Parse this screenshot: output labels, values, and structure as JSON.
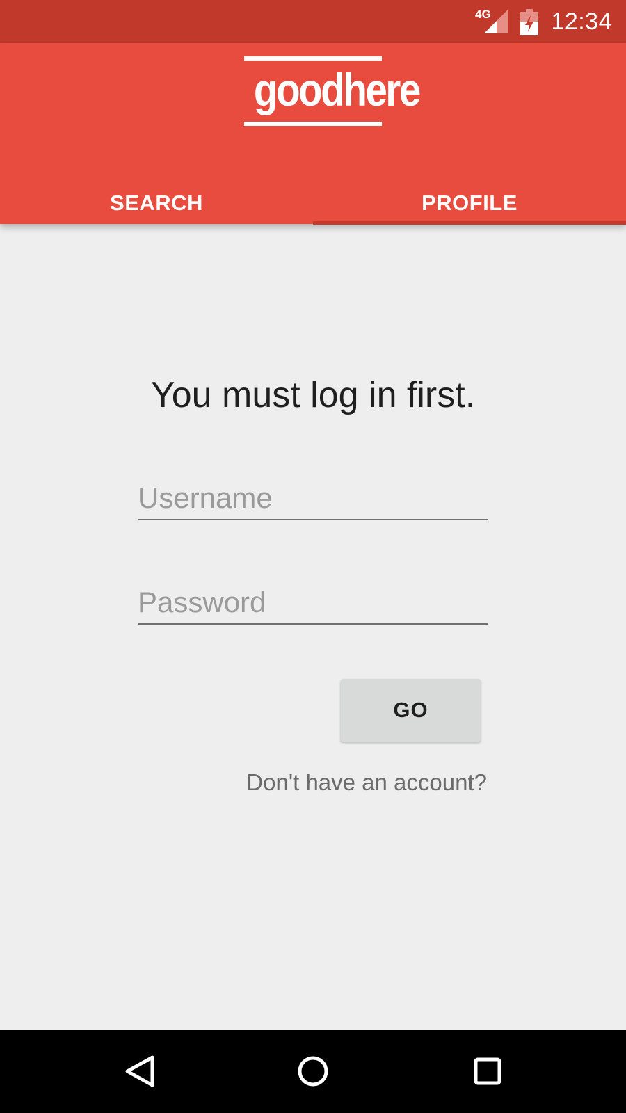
{
  "status_bar": {
    "network": "4G",
    "time": "12:34",
    "icons": [
      "signal-icon",
      "battery-charging-icon"
    ]
  },
  "app_bar": {
    "logo_text": "goodhere",
    "tabs": [
      {
        "label": "SEARCH",
        "selected": false
      },
      {
        "label": "PROFILE",
        "selected": true
      }
    ],
    "colors": {
      "primary": "#e74c3f",
      "status": "#c1392b",
      "indicator": "#c5392c"
    }
  },
  "login": {
    "prompt": "You must log in first.",
    "username": {
      "value": "",
      "placeholder": "Username"
    },
    "password": {
      "value": "",
      "placeholder": "Password"
    },
    "go_label": "GO",
    "signup_text": "Don't have an account?"
  },
  "nav_bar": {
    "icons": [
      "back-icon",
      "home-icon",
      "recents-icon"
    ]
  }
}
